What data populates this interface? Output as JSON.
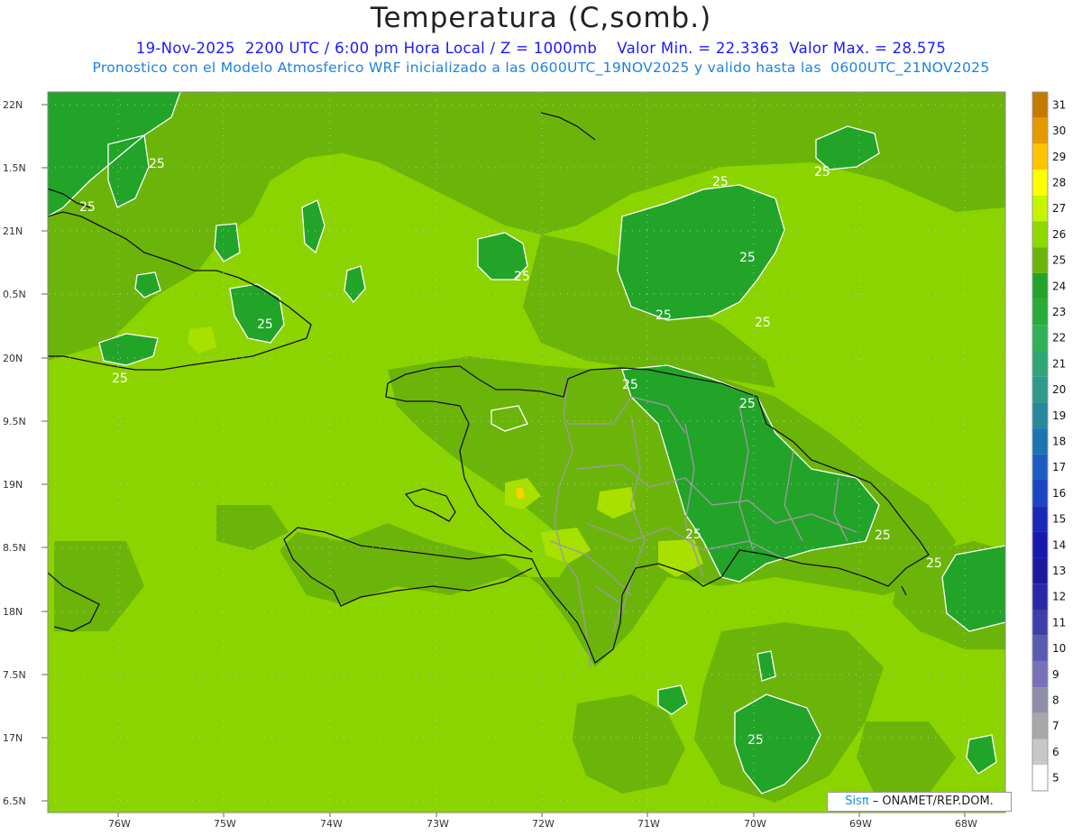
{
  "header": {
    "title": "Temperatura (C,somb.)",
    "subtitle1": "19-Nov-2025  2200 UTC / 6:00 pm Hora Local / Z = 1000mb    Valor Min. = 22.3363  Valor Max. = 28.575",
    "subtitle2": "Pronostico con el Modelo Atmosferico WRF inicializado a las 0600UTC_19NOV2025 y valido hasta las  0600UTC_21NOV2025"
  },
  "map": {
    "lat_labels": [
      "22N",
      "1.5N",
      "21N",
      "0.5N",
      "20N",
      "9.5N",
      "19N",
      "8.5N",
      "18N",
      "7.5N",
      "17N",
      "6.5N"
    ],
    "lon_labels": [
      "76W",
      "75W",
      "74W",
      "73W",
      "72W",
      "71W",
      "70W",
      "69W",
      "68W"
    ],
    "contour_label": "25",
    "colors": {
      "background_field": "#8cd400",
      "field_24_25": "#6bb50a",
      "field_23_24": "#22a428",
      "field_26_27": "#a8e000",
      "coast": "#111111",
      "borders": "#999999"
    }
  },
  "colorbar": {
    "levels": [
      "31",
      "30",
      "29",
      "28",
      "27",
      "26",
      "25",
      "24",
      "23",
      "22",
      "21",
      "20",
      "19",
      "18",
      "17",
      "16",
      "15",
      "14",
      "13",
      "12",
      "11",
      "10",
      "9",
      "8",
      "7",
      "6",
      "5"
    ],
    "colors": [
      "#c47a00",
      "#e69a00",
      "#ffc400",
      "#ffff00",
      "#c6f500",
      "#8ed900",
      "#6bb50a",
      "#22a428",
      "#28ac3a",
      "#2fb257",
      "#2fa676",
      "#2d9a8c",
      "#26889d",
      "#1c74b0",
      "#1c5cc2",
      "#1c44c4",
      "#1828b8",
      "#1818b0",
      "#1a1aa0",
      "#2828a8",
      "#3e3ea8",
      "#5a5ab0",
      "#7870b8",
      "#8e8ea8",
      "#a8a8a8",
      "#c8c8c8",
      "#ffffff"
    ]
  },
  "credit": {
    "sis": "Sisπ",
    "text": " – ONAMET/REP.DOM."
  }
}
